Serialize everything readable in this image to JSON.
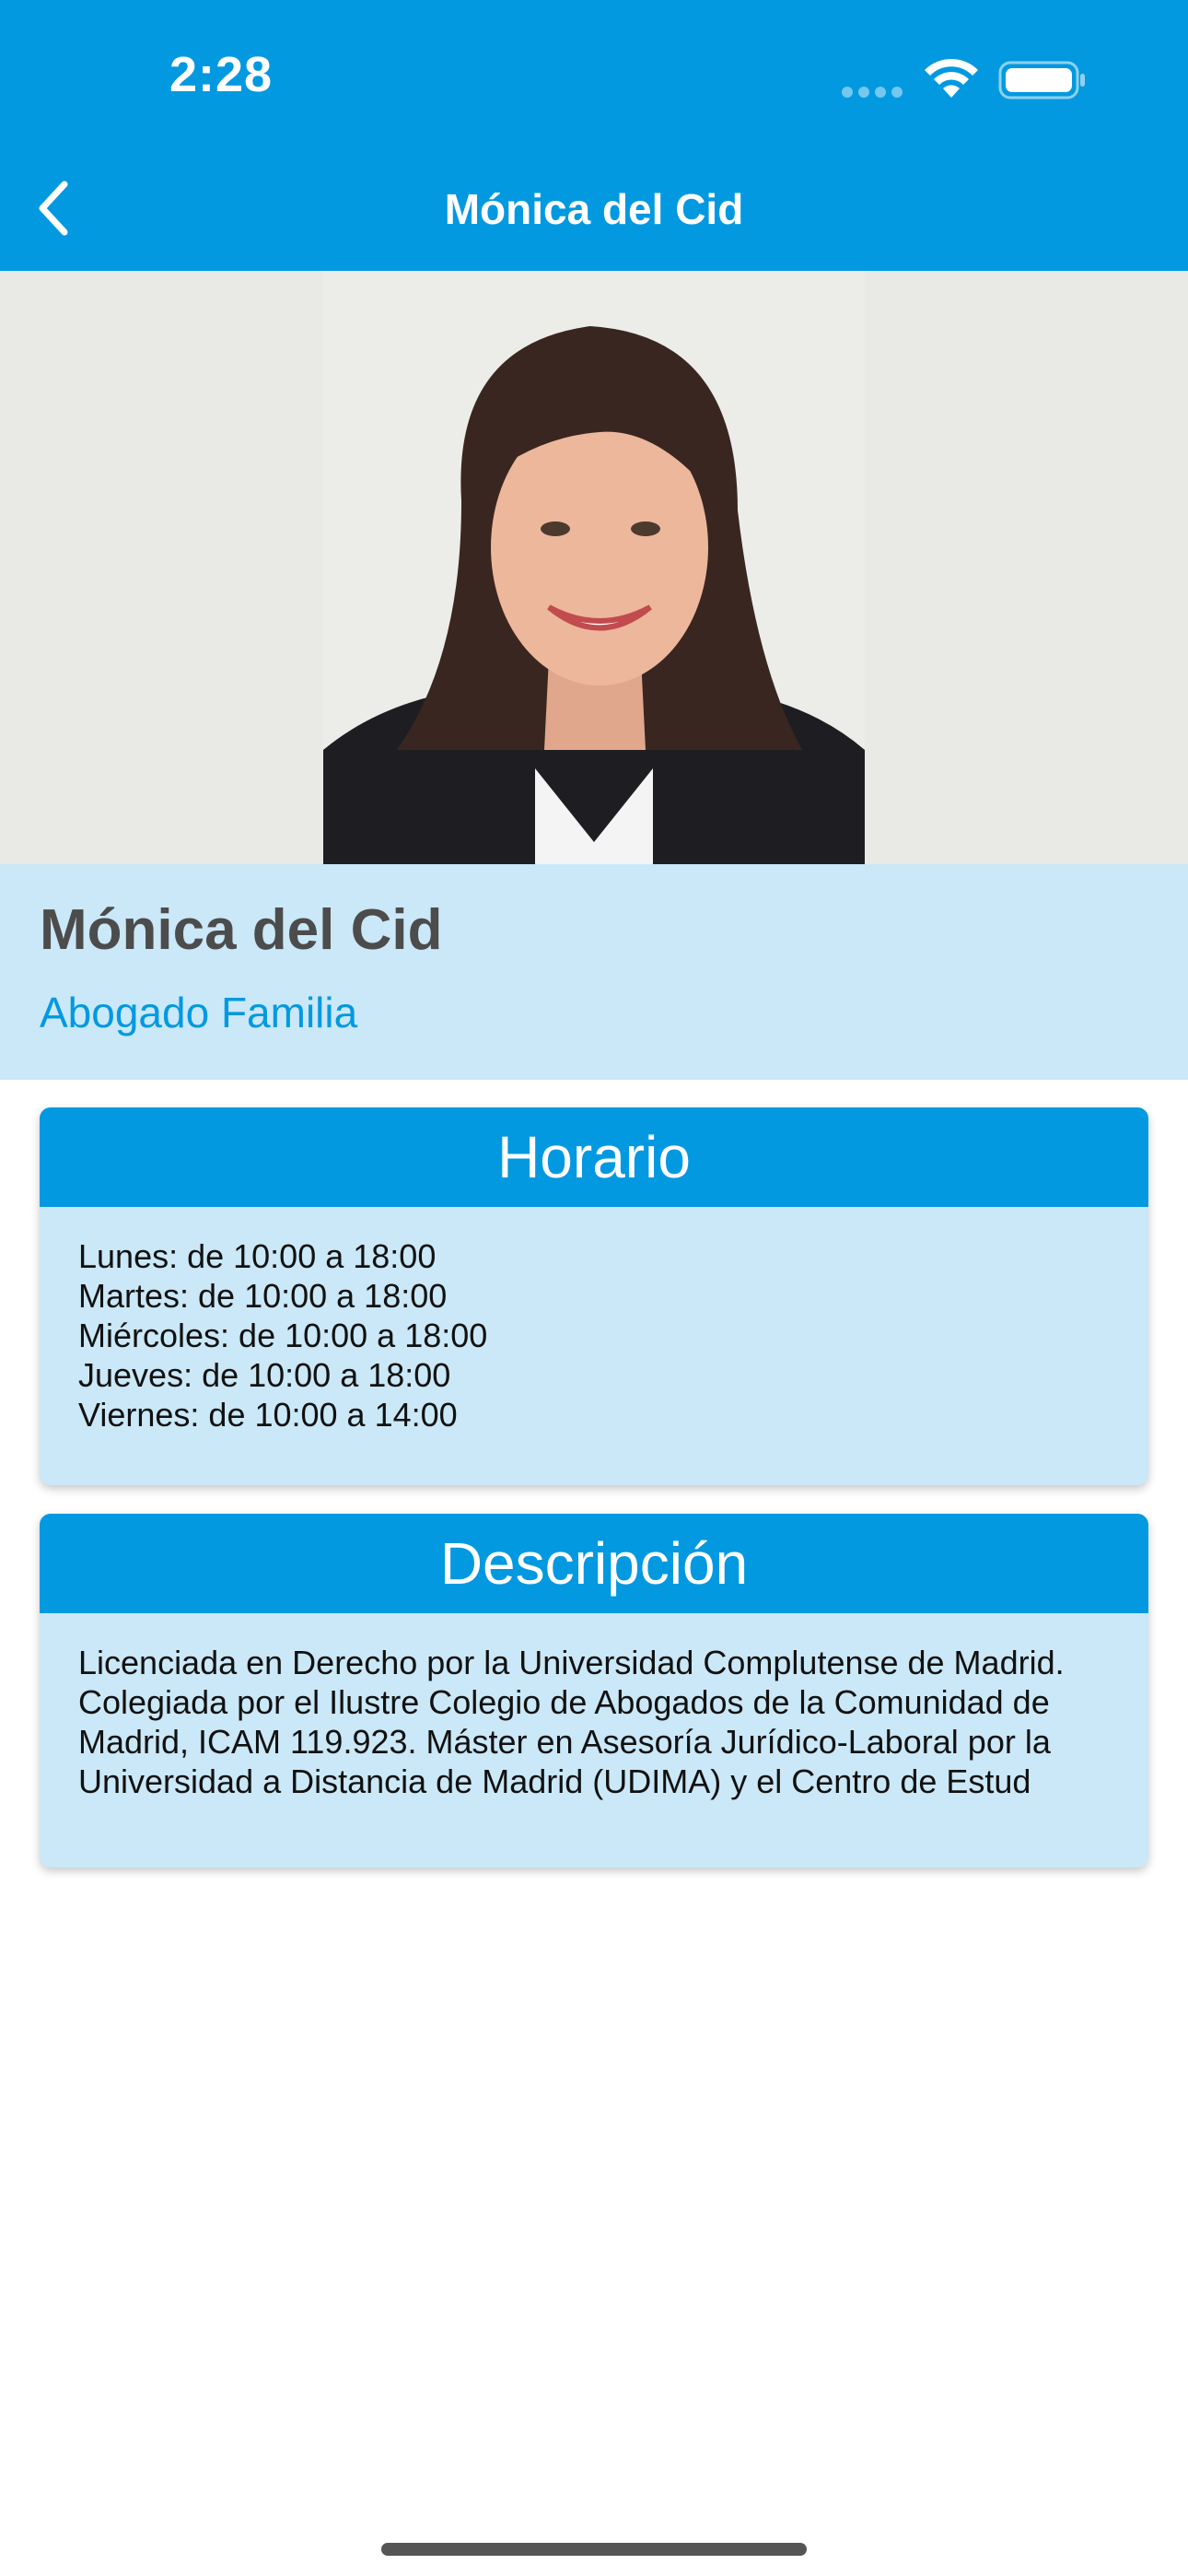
{
  "status_bar": {
    "time": "2:28"
  },
  "nav": {
    "title": "Mónica del Cid"
  },
  "profile": {
    "name": "Mónica del Cid",
    "role": "Abogado Familia"
  },
  "schedule": {
    "title": "Horario",
    "lines": [
      "Lunes: de 10:00 a 18:00",
      "Martes: de 10:00 a 18:00",
      "Miércoles: de 10:00 a 18:00",
      "Jueves: de 10:00 a 18:00",
      "Viernes: de 10:00 a 14:00"
    ]
  },
  "description": {
    "title": "Descripción",
    "text": "Licenciada en Derecho por la Universidad Complutense de Madrid. Colegiada por el Ilustre Colegio de Abogados de la Comunidad de Madrid, ICAM 119.923. Máster en Asesoría Jurídico-Laboral por la Universidad a Distancia de Madrid (UDIMA) y el Centro de Estud"
  },
  "icons": {
    "back": "chevron-left-icon",
    "wifi": "wifi-icon",
    "battery": "battery-icon",
    "signal": "cellular-signal-icon"
  },
  "colors": {
    "primary": "#0399E0",
    "light_band": "#CAE8F7",
    "name_text": "#4C4C4C",
    "photo_bg": "#E9EAE6"
  }
}
